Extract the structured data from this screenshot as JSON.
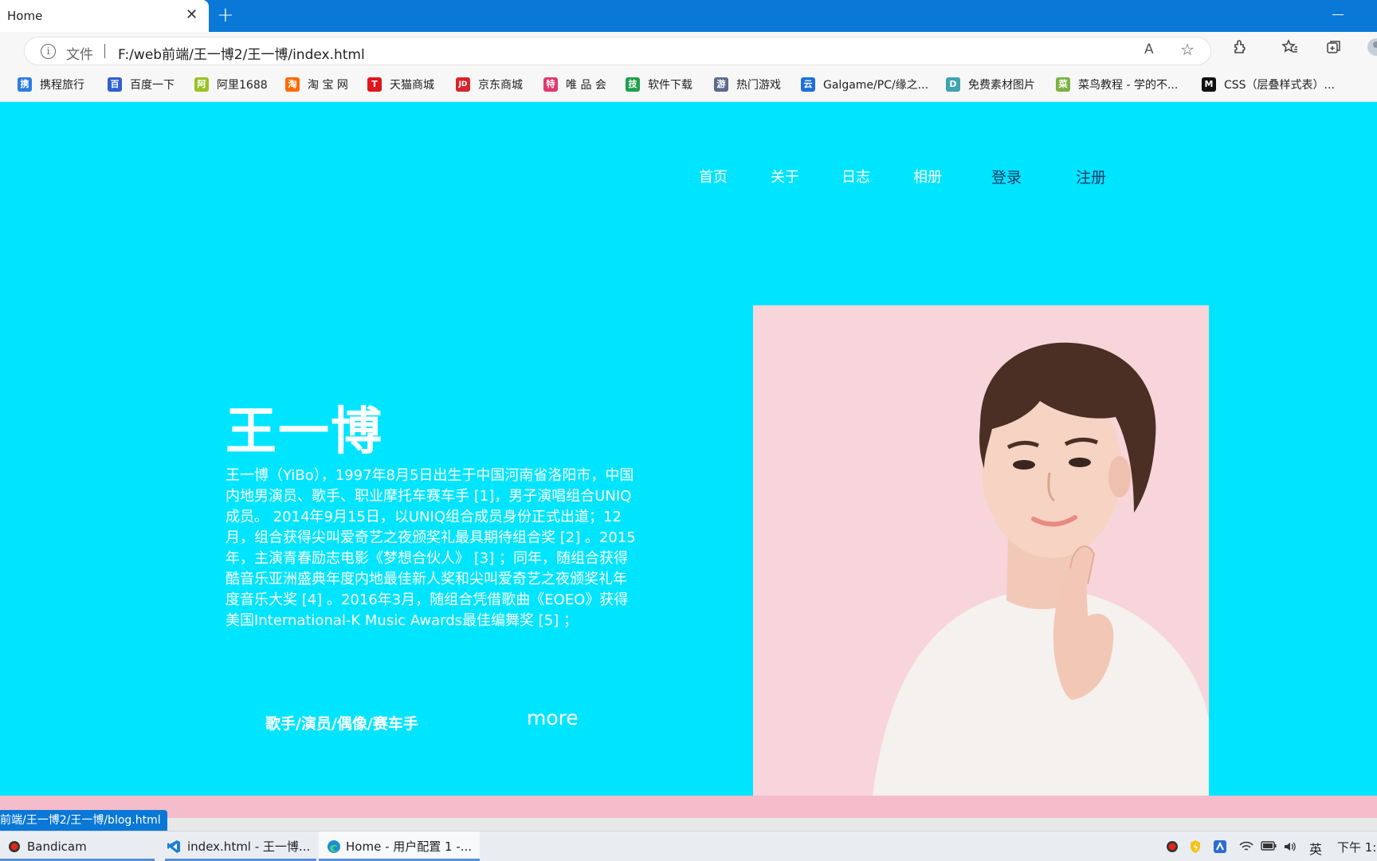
{
  "browser": {
    "tab_title": "Home",
    "tab_close": "✕",
    "new_tab": "+",
    "info_icon": "i",
    "file_label": "文件",
    "url": "F:/web前端/王一博2/王一博/index.html",
    "read_aloud_icon": "A",
    "add_favorite_icon": "☆"
  },
  "bookmarks": [
    {
      "label": "携程旅行",
      "icon": "ctrip-icon",
      "color": "#2b7de0"
    },
    {
      "label": "百度一下",
      "icon": "baidu-paw-icon",
      "color": "#2f5fd0"
    },
    {
      "label": "阿里1688",
      "icon": "leaf-icon",
      "color": "#9ac224"
    },
    {
      "label": "淘 宝 网",
      "icon": "taobao-icon",
      "color": "#ff6a00"
    },
    {
      "label": "天猫商城",
      "icon": "tmall-icon",
      "color": "#e0161c"
    },
    {
      "label": "京东商城",
      "icon": "jd-icon",
      "color": "#d6252b"
    },
    {
      "label": "唯 品 会",
      "icon": "vip-icon",
      "color": "#e1386e"
    },
    {
      "label": "软件下载",
      "icon": "software-icon",
      "color": "#1fa04a"
    },
    {
      "label": "热门游戏",
      "icon": "game-icon",
      "color": "#5b6b8c"
    },
    {
      "label": "Galgame/PC/缘之...",
      "icon": "cloud-icon",
      "color": "#1e6fd9"
    },
    {
      "label": "免费素材图片",
      "icon": "image-icon",
      "color": "#3fa3b0"
    },
    {
      "label": "菜鸟教程 - 学的不...",
      "icon": "runoob-icon",
      "color": "#7bb342"
    },
    {
      "label": "CSS（层叠样式表）...",
      "icon": "mdn-icon",
      "color": "#111111"
    }
  ],
  "bookmark_glyphs": [
    "携",
    "百",
    "阿",
    "淘",
    "T",
    "JD",
    "特",
    "技",
    "游",
    "云",
    "D",
    "菜",
    "M"
  ],
  "nav": {
    "home": "首页",
    "about": "关于",
    "log": "日志",
    "album": "相册",
    "login": "登录",
    "register": "注册"
  },
  "hero": {
    "name": "王一博",
    "bio": "王一博（YiBo），1997年8月5日出生于中国河南省洛阳市，中国内地男演员、歌手、职业摩托车赛车手 [1]，男子演唱组合UNIQ成员。 2014年9月15日，以UNIQ组合成员身份正式出道；12月，组合获得尖叫爱奇艺之夜颁奖礼最具期待组合奖 [2] 。2015年，主演青春励志电影《梦想合伙人》 [3] ；同年，随组合获得酷音乐亚洲盛典年度内地最佳新人奖和尖叫爱奇艺之夜颁奖礼年度音乐大奖 [4] 。2016年3月，随组合凭借歌曲《EOEO》获得美国International-K Music Awards最佳编舞奖 [5] ；",
    "tag": "歌手/演员/偶像/赛车手",
    "more": "more"
  },
  "status_bar": {
    "link": "前端/王一博2/王一博/blog.html"
  },
  "taskbar": {
    "apps": [
      {
        "label": "Bandicam"
      },
      {
        "label": "index.html - 王一博..."
      },
      {
        "label": "Home - 用户配置 1 -..."
      }
    ],
    "ime": "英",
    "clock": "下午 1:"
  },
  "colors": {
    "page_background": "#00e5ff",
    "photo_background": "#f8d5da",
    "bottom_strip": "#f5bccb",
    "accent": "#0a78d7"
  }
}
